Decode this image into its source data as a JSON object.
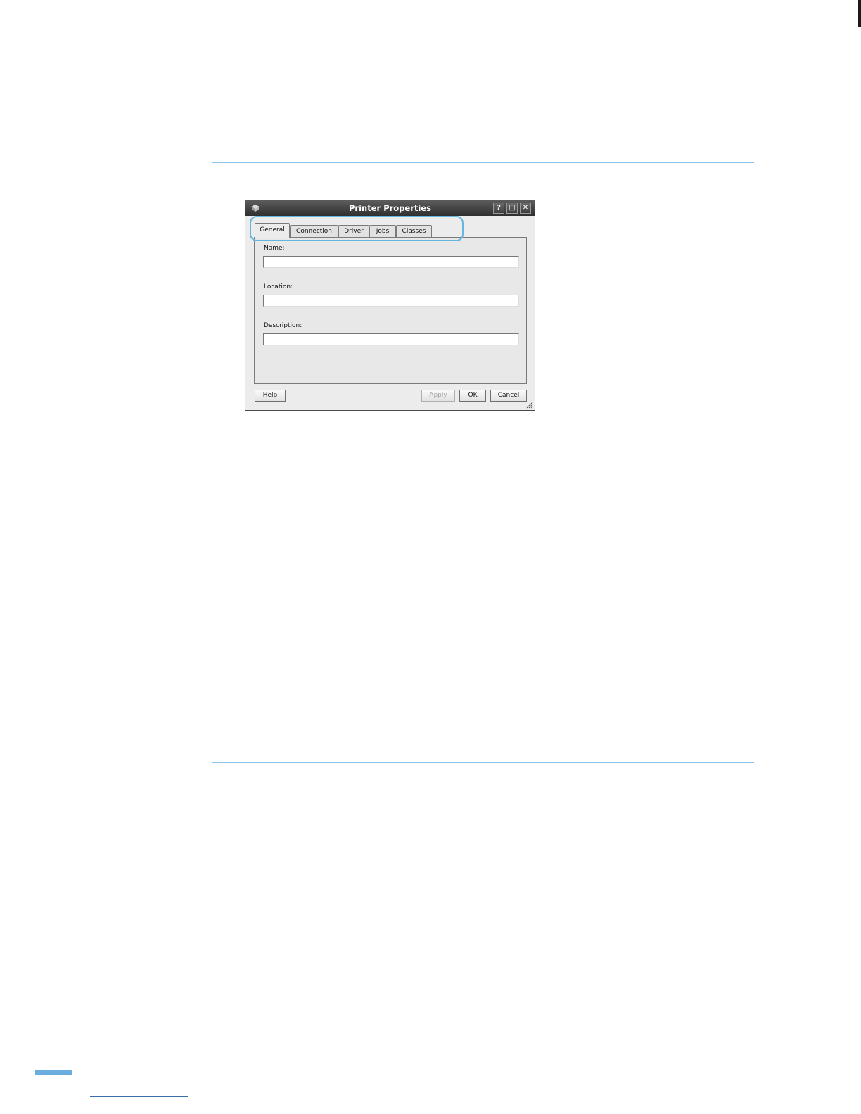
{
  "dialog": {
    "title": "Printer Properties",
    "title_buttons": {
      "help": "?",
      "maximize": "□",
      "close": "✕"
    }
  },
  "tabs": [
    {
      "label": "General",
      "active": true
    },
    {
      "label": "Connection",
      "active": false
    },
    {
      "label": "Driver",
      "active": false
    },
    {
      "label": "Jobs",
      "active": false
    },
    {
      "label": "Classes",
      "active": false
    }
  ],
  "general": {
    "name_label": "Name:",
    "name_value": "",
    "location_label": "Location:",
    "location_value": "",
    "description_label": "Description:",
    "description_value": ""
  },
  "buttons": {
    "help": "Help",
    "apply": "Apply",
    "ok": "OK",
    "cancel": "Cancel"
  },
  "colors": {
    "accent_rule": "#8cc3e6",
    "tab_highlight": "#66b5df",
    "footer_tab": "#6aaee0"
  },
  "icons": {
    "app": "printer-icon",
    "resize": "resize-grip-icon"
  }
}
